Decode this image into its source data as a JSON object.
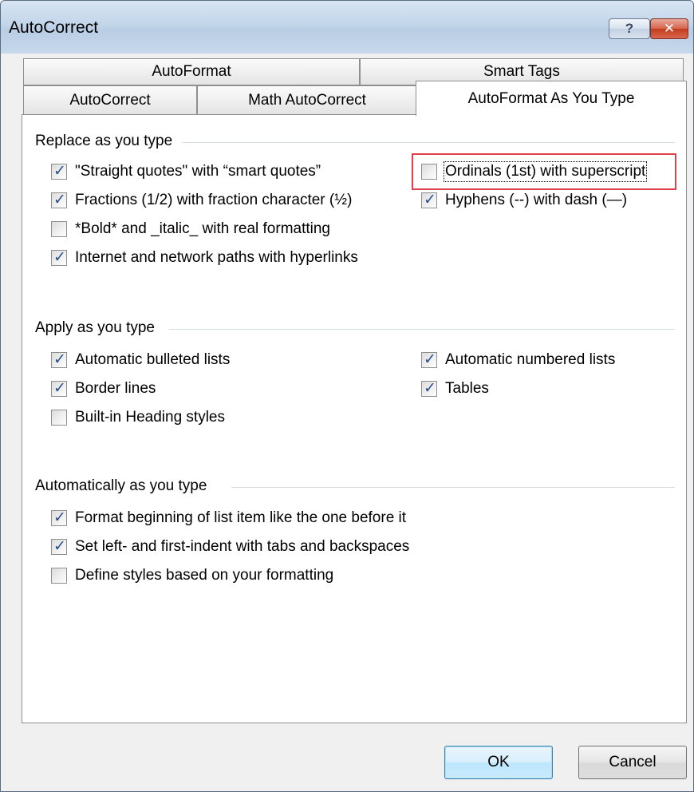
{
  "window": {
    "title": "AutoCorrect",
    "help_label": "?",
    "close_label": "✕"
  },
  "tabs": {
    "row1": [
      "AutoFormat",
      "Smart Tags"
    ],
    "row2": [
      "AutoCorrect",
      "Math AutoCorrect",
      "AutoFormat As You Type"
    ],
    "active": "AutoFormat As You Type"
  },
  "groups": {
    "replace": {
      "title": "Replace as you type",
      "left": [
        {
          "label": "\"Straight quotes\" with “smart quotes”",
          "checked": true
        },
        {
          "label": "Fractions (1/2) with fraction character (½)",
          "checked": true
        },
        {
          "label": "*Bold* and _italic_ with real formatting",
          "checked": false
        },
        {
          "label": "Internet and network paths with hyperlinks",
          "checked": true
        }
      ],
      "right": [
        {
          "label": "Ordinals (1st) with superscript",
          "checked": false
        },
        {
          "label": "Hyphens (--) with dash (—)",
          "checked": true
        }
      ]
    },
    "apply": {
      "title": "Apply as you type",
      "left": [
        {
          "label": "Automatic bulleted lists",
          "checked": true
        },
        {
          "label": "Border lines",
          "checked": true
        },
        {
          "label": "Built-in Heading styles",
          "checked": false
        }
      ],
      "right": [
        {
          "label": "Automatic numbered lists",
          "checked": true
        },
        {
          "label": "Tables",
          "checked": true
        }
      ]
    },
    "auto": {
      "title": "Automatically as you type",
      "left": [
        {
          "label": "Format beginning of list item like the one before it",
          "checked": true
        },
        {
          "label": "Set left- and first-indent with tabs and backspaces",
          "checked": true
        },
        {
          "label": "Define styles based on your formatting",
          "checked": false
        }
      ]
    }
  },
  "buttons": {
    "ok": "OK",
    "cancel": "Cancel"
  },
  "colors": {
    "highlight_box": "#e0424a",
    "checkmark": "#2a4f8a"
  }
}
